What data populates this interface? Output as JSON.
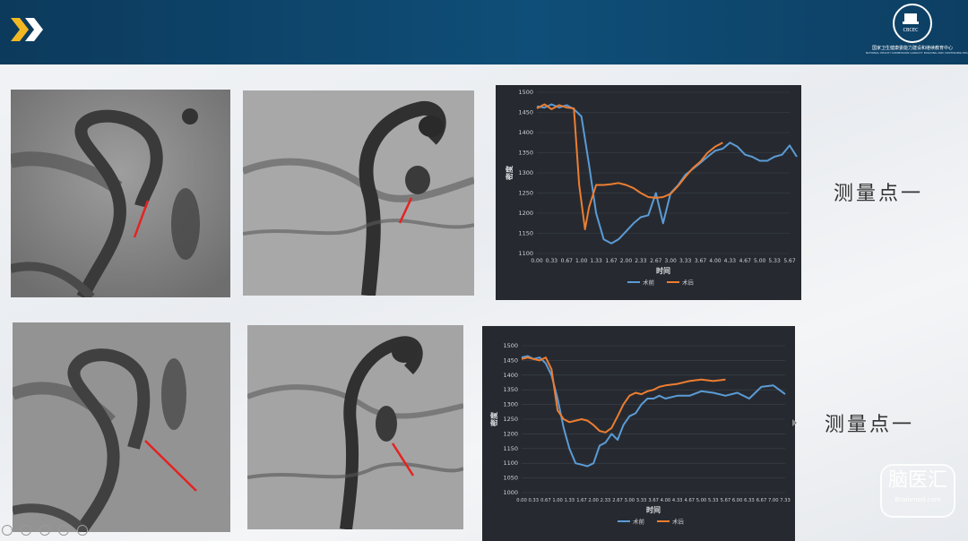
{
  "header": {
    "logo_text": "CBCEC",
    "org_name": "国家卫生健康委能力建设和继续教育中心",
    "org_name_en": "NATIONAL HEALTH COMMISSION CAPACITY BUILDING AND CONTINUING EDUCATION CENTER",
    "colors": {
      "bar": "#0f4e78",
      "accent": "#f2b823"
    }
  },
  "labels": {
    "point1": "测量点一",
    "point2": "测量点一"
  },
  "watermark": {
    "cn": "脑医汇",
    "en": "Brainmed.com"
  },
  "chart_data": [
    {
      "type": "line",
      "xlabel": "时间",
      "ylabel": "密度",
      "ylim": [
        1100,
        1500
      ],
      "yticks": [
        1100,
        1150,
        1200,
        1250,
        1300,
        1350,
        1400,
        1450,
        1500
      ],
      "xticks": [
        "0.00",
        "0.33",
        "0.67",
        "1.00",
        "1.33",
        "1.67",
        "2.00",
        "2.33",
        "2.67",
        "3.00",
        "3.33",
        "3.67",
        "4.00",
        "4.33",
        "4.67",
        "5.00",
        "5.33",
        "5.67"
      ],
      "legend_position": "bottom",
      "series": [
        {
          "name": "术前",
          "color": "#5b9bd5",
          "x": [
            0.0,
            0.17,
            0.33,
            0.5,
            0.67,
            0.83,
            1.0,
            1.17,
            1.33,
            1.5,
            1.67,
            1.83,
            2.0,
            2.17,
            2.33,
            2.5,
            2.67,
            2.83,
            3.0,
            3.17,
            3.33,
            3.5,
            3.67,
            3.83,
            4.0,
            4.17,
            4.33,
            4.5,
            4.67,
            4.83,
            5.0,
            5.17,
            5.33,
            5.5,
            5.67,
            5.83
          ],
          "values": [
            1465,
            1462,
            1470,
            1462,
            1468,
            1458,
            1440,
            1320,
            1200,
            1135,
            1125,
            1135,
            1155,
            1175,
            1190,
            1195,
            1250,
            1175,
            1250,
            1270,
            1295,
            1310,
            1325,
            1340,
            1355,
            1360,
            1375,
            1365,
            1345,
            1340,
            1330,
            1330,
            1340,
            1345,
            1368,
            1340
          ]
        },
        {
          "name": "术后",
          "color": "#ed7d31",
          "x": [
            0.0,
            0.17,
            0.33,
            0.5,
            0.67,
            0.83,
            0.95,
            1.08,
            1.17,
            1.33,
            1.5,
            1.67,
            1.83,
            2.0,
            2.17,
            2.33,
            2.5,
            2.67,
            2.83,
            3.0,
            3.17,
            3.33,
            3.5,
            3.67,
            3.83,
            4.0,
            4.17
          ],
          "values": [
            1460,
            1470,
            1458,
            1468,
            1462,
            1460,
            1270,
            1160,
            1215,
            1270,
            1270,
            1272,
            1275,
            1270,
            1262,
            1250,
            1240,
            1238,
            1240,
            1248,
            1268,
            1290,
            1312,
            1328,
            1350,
            1365,
            1375
          ]
        }
      ]
    },
    {
      "type": "line",
      "xlabel": "时间",
      "ylabel": "密度",
      "ylim": [
        1000,
        1500
      ],
      "yticks": [
        1000,
        1050,
        1100,
        1150,
        1200,
        1250,
        1300,
        1350,
        1400,
        1450,
        1500
      ],
      "xticks": [
        "0.00",
        "0.33",
        "0.67",
        "1.00",
        "1.33",
        "1.67",
        "2.00",
        "2.33",
        "2.67",
        "3.00",
        "3.33",
        "3.67",
        "4.00",
        "4.33",
        "4.67",
        "5.00",
        "5.33",
        "5.67",
        "6.00",
        "6.33",
        "6.67",
        "7.00",
        "7.33"
      ],
      "legend_position": "bottom",
      "series": [
        {
          "name": "术前",
          "color": "#5b9bd5",
          "x": [
            0.0,
            0.17,
            0.33,
            0.5,
            0.67,
            0.83,
            1.0,
            1.17,
            1.33,
            1.5,
            1.67,
            1.83,
            2.0,
            2.17,
            2.33,
            2.5,
            2.67,
            2.83,
            3.0,
            3.17,
            3.33,
            3.5,
            3.67,
            3.83,
            4.0,
            4.33,
            4.67,
            5.0,
            5.33,
            5.67,
            6.0,
            6.33,
            6.67,
            7.0,
            7.33
          ],
          "values": [
            1460,
            1465,
            1455,
            1460,
            1440,
            1400,
            1320,
            1220,
            1150,
            1100,
            1095,
            1090,
            1100,
            1160,
            1170,
            1200,
            1180,
            1230,
            1260,
            1270,
            1300,
            1320,
            1320,
            1330,
            1320,
            1330,
            1330,
            1345,
            1340,
            1330,
            1340,
            1320,
            1360,
            1365,
            1335
          ]
        },
        {
          "name": "术后",
          "color": "#ed7d31",
          "x": [
            0.0,
            0.17,
            0.33,
            0.5,
            0.67,
            0.83,
            1.0,
            1.17,
            1.33,
            1.5,
            1.67,
            1.83,
            2.0,
            2.17,
            2.33,
            2.5,
            2.67,
            2.83,
            3.0,
            3.17,
            3.33,
            3.5,
            3.67,
            3.83,
            4.0,
            4.33,
            4.67,
            5.0,
            5.33,
            5.67
          ],
          "values": [
            1455,
            1460,
            1455,
            1450,
            1460,
            1420,
            1280,
            1250,
            1240,
            1245,
            1250,
            1245,
            1230,
            1210,
            1205,
            1220,
            1260,
            1300,
            1330,
            1340,
            1335,
            1345,
            1350,
            1360,
            1365,
            1370,
            1380,
            1385,
            1380,
            1385
          ]
        }
      ]
    }
  ]
}
